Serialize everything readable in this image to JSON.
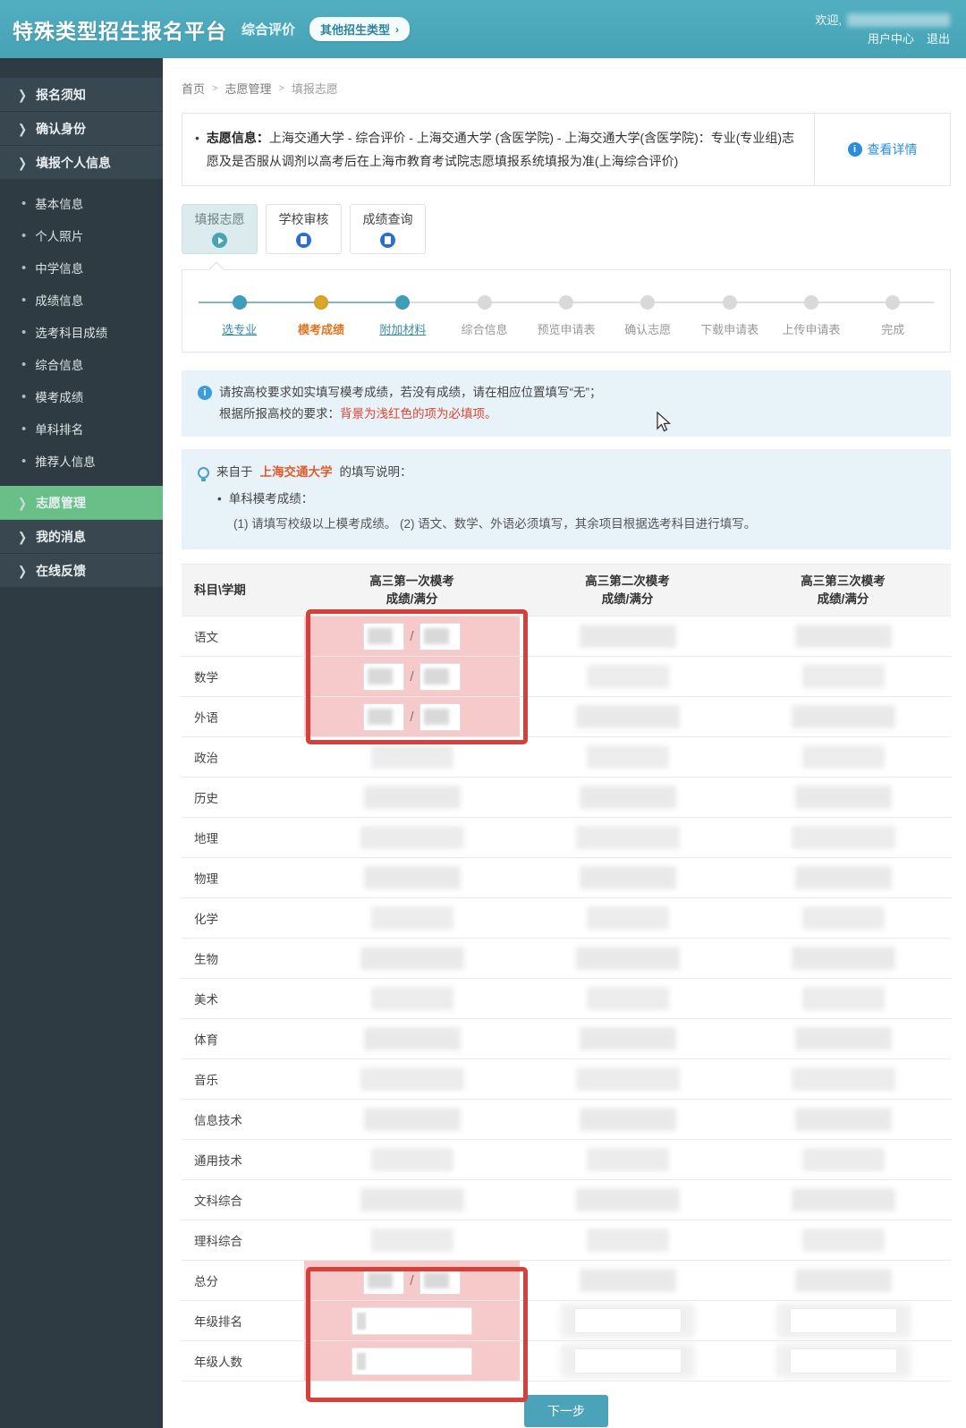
{
  "header": {
    "title": "特殊类型招生报名平台",
    "subtitle": "综合评价",
    "other_types_button": "其他招生类型",
    "chevron": "›",
    "welcome": "欢迎,",
    "user_center": "用户中心",
    "logout": "退出"
  },
  "colors": {
    "header_teal": "#49a5b7",
    "sidebar_dark": "#2e3b42",
    "active_green": "#68bf88",
    "required_pink": "#f6caca",
    "annotation_red": "#d5413a",
    "link_blue": "#2a8fd8",
    "step_current_gold": "#d9a62a",
    "step_done_teal": "#3f9dba"
  },
  "sidebar": {
    "items": [
      {
        "label": "报名须知",
        "type": "arrow",
        "active": false
      },
      {
        "label": "确认身份",
        "type": "arrow",
        "active": false
      },
      {
        "label": "填报个人信息",
        "type": "arrow",
        "active": false
      },
      {
        "label": "基本信息",
        "type": "dot",
        "active": false
      },
      {
        "label": "个人照片",
        "type": "dot",
        "active": false
      },
      {
        "label": "中学信息",
        "type": "dot",
        "active": false
      },
      {
        "label": "成绩信息",
        "type": "dot",
        "active": false
      },
      {
        "label": "选考科目成绩",
        "type": "dot",
        "active": false
      },
      {
        "label": "综合信息",
        "type": "dot",
        "active": false
      },
      {
        "label": "模考成绩",
        "type": "dot",
        "active": false
      },
      {
        "label": "单科排名",
        "type": "dot",
        "active": false
      },
      {
        "label": "推荐人信息",
        "type": "dot",
        "active": false
      },
      {
        "label": "志愿管理",
        "type": "arrow",
        "active": true
      },
      {
        "label": "我的消息",
        "type": "arrow",
        "active": false
      },
      {
        "label": "在线反馈",
        "type": "arrow",
        "active": false
      }
    ]
  },
  "breadcrumb": [
    "首页",
    "志愿管理",
    "填报志愿"
  ],
  "info_bar": {
    "bullet": "•",
    "label": "志愿信息：",
    "text": "上海交通大学 - 综合评价 - 上海交通大学 (含医学院)  - 上海交通大学(含医学院)：专业(专业组)志愿及是否服从调剂以高考后在上海市教育考试院志愿填报系统填报为准(上海综合评价)",
    "detail_link": "查看详情",
    "info_icon": "i"
  },
  "tabs": [
    {
      "label": "填报志愿",
      "icon": "play-icon",
      "active": true
    },
    {
      "label": "学校审核",
      "icon": "audit-icon",
      "active": false
    },
    {
      "label": "成绩查询",
      "icon": "query-icon",
      "active": false
    }
  ],
  "stepper": [
    {
      "label": "选专业",
      "state": "done"
    },
    {
      "label": "模考成绩",
      "state": "current"
    },
    {
      "label": "附加材料",
      "state": "done"
    },
    {
      "label": "综合信息",
      "state": "todo"
    },
    {
      "label": "预览申请表",
      "state": "todo"
    },
    {
      "label": "确认志愿",
      "state": "todo"
    },
    {
      "label": "下载申请表",
      "state": "todo"
    },
    {
      "label": "上传申请表",
      "state": "todo"
    },
    {
      "label": "完成",
      "state": "todo"
    }
  ],
  "notices": {
    "line1": "请按高校要求如实填写模考成绩，若没有成绩，请在相应位置填写“无”；",
    "line2_prefix": "根据所报高校的要求：",
    "line2_red": "背景为浅红色的项为必填项。",
    "from_prefix": "来自于",
    "school": "上海交通大学",
    "from_suffix": "的填写说明：",
    "bullet_title": "单科模考成绩：",
    "bullet_dot": "•",
    "detail": "(1) 请填写校级以上模考成绩。  (2) 语文、数学、外语必须填写，其余项目根据选考科目进行填写。"
  },
  "table": {
    "col1_header": "科目\\学期",
    "exam_headers": [
      "高三第一次模考",
      "高三第二次模考",
      "高三第三次模考"
    ],
    "sub_header": "成绩/满分",
    "slash": "/",
    "rows": [
      {
        "label": "语文",
        "c2": "pair",
        "c3": "blur",
        "c4": "blur",
        "required": true
      },
      {
        "label": "数学",
        "c2": "pair",
        "c3": "blur",
        "c4": "blur",
        "required": true
      },
      {
        "label": "外语",
        "c2": "pair",
        "c3": "blur",
        "c4": "blur",
        "required": true
      },
      {
        "label": "政治",
        "c2": "blur",
        "c3": "blur",
        "c4": "blur",
        "required": false
      },
      {
        "label": "历史",
        "c2": "blur",
        "c3": "blur",
        "c4": "blur",
        "required": false
      },
      {
        "label": "地理",
        "c2": "blur",
        "c3": "blur",
        "c4": "blur",
        "required": false
      },
      {
        "label": "物理",
        "c2": "blur",
        "c3": "blur",
        "c4": "blur",
        "required": false
      },
      {
        "label": "化学",
        "c2": "blur",
        "c3": "blur",
        "c4": "blur",
        "required": false
      },
      {
        "label": "生物",
        "c2": "blur",
        "c3": "blur",
        "c4": "blur",
        "required": false
      },
      {
        "label": "美术",
        "c2": "blur",
        "c3": "blur",
        "c4": "blur",
        "required": false
      },
      {
        "label": "体育",
        "c2": "blur",
        "c3": "blur",
        "c4": "blur",
        "required": false
      },
      {
        "label": "音乐",
        "c2": "blur",
        "c3": "blur",
        "c4": "blur",
        "required": false
      },
      {
        "label": "信息技术",
        "c2": "blur",
        "c3": "blur",
        "c4": "blur",
        "required": false
      },
      {
        "label": "通用技术",
        "c2": "blur",
        "c3": "blur",
        "c4": "blur",
        "required": false
      },
      {
        "label": "文科综合",
        "c2": "blur",
        "c3": "blur",
        "c4": "blur",
        "required": false
      },
      {
        "label": "理科综合",
        "c2": "blur",
        "c3": "blur",
        "c4": "blur",
        "required": false
      },
      {
        "label": "总分",
        "c2": "pair",
        "c3": "blur",
        "c4": "blur",
        "required": true
      },
      {
        "label": "年级排名",
        "c2": "single",
        "c3": "input",
        "c4": "input",
        "required": true
      },
      {
        "label": "年级人数",
        "c2": "single",
        "c3": "input",
        "c4": "input",
        "required": true
      }
    ]
  },
  "next_button": "下一步"
}
